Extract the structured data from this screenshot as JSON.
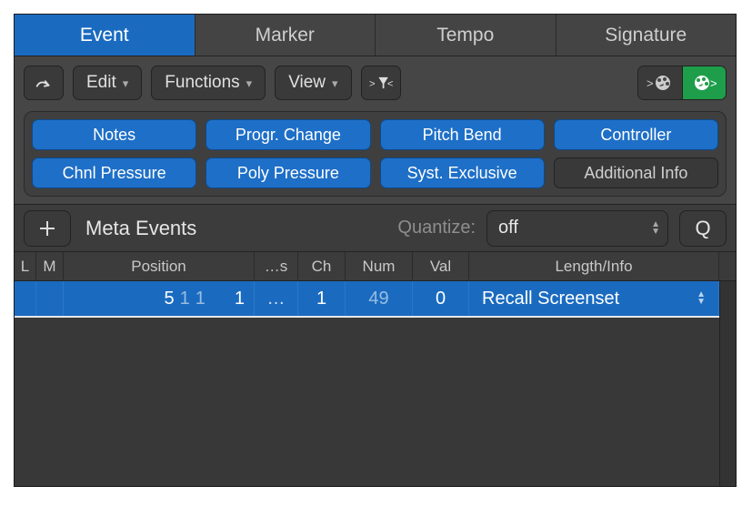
{
  "tabs": [
    {
      "label": "Event",
      "active": true
    },
    {
      "label": "Marker",
      "active": false
    },
    {
      "label": "Tempo",
      "active": false
    },
    {
      "label": "Signature",
      "active": false
    }
  ],
  "toolbar": {
    "edit_label": "Edit",
    "functions_label": "Functions",
    "view_label": "View"
  },
  "filters": {
    "row1": [
      {
        "label": "Notes",
        "on": true
      },
      {
        "label": "Progr. Change",
        "on": true
      },
      {
        "label": "Pitch Bend",
        "on": true
      },
      {
        "label": "Controller",
        "on": true
      }
    ],
    "row2": [
      {
        "label": "Chnl Pressure",
        "on": true
      },
      {
        "label": "Poly Pressure",
        "on": true
      },
      {
        "label": "Syst. Exclusive",
        "on": true
      },
      {
        "label": "Additional Info",
        "on": false
      }
    ]
  },
  "subbar": {
    "title": "Meta Events",
    "quantize_label": "Quantize:",
    "quantize_value": "off",
    "q_button": "Q"
  },
  "columns": {
    "L": "L",
    "M": "M",
    "position": "Position",
    "status": "…s",
    "ch": "Ch",
    "num": "Num",
    "val": "Val",
    "info": "Length/Info"
  },
  "rows": [
    {
      "pos_bar": "5",
      "pos_beat": "1",
      "pos_div": "1",
      "pos_tick": "1",
      "status": "…",
      "ch": "1",
      "num": "49",
      "val": "0",
      "info": "Recall Screenset"
    }
  ]
}
